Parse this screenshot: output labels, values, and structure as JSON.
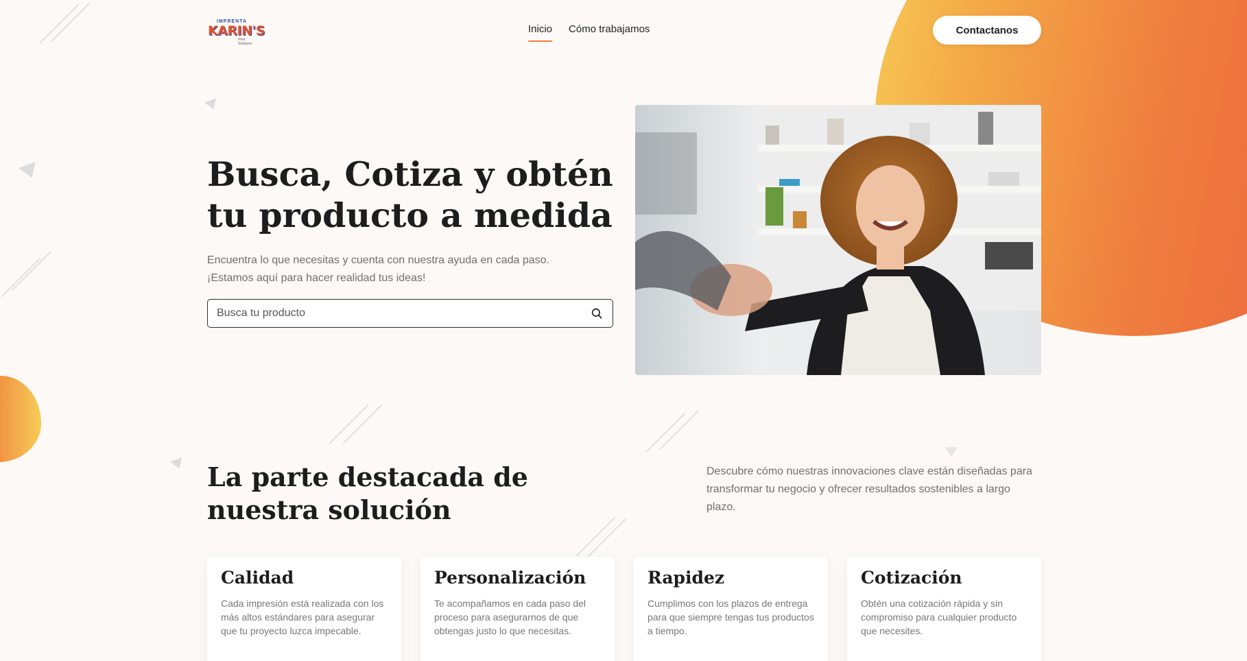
{
  "header": {
    "logo": {
      "top_text": "IMPRENTA",
      "main_text": "KARIN'S",
      "tagline": "Print Solutions"
    },
    "nav": [
      {
        "label": "Inicio",
        "active": true
      },
      {
        "label": "Cómo trabajamos",
        "active": false
      }
    ],
    "contact_button": "Contactanos"
  },
  "hero": {
    "title": "Busca, Cotiza y obtén tu producto a medida",
    "subtitle_line1": "Encuentra lo que necesitas y cuenta con nuestra ayuda en cada paso.",
    "subtitle_line2": "¡Estamos aquí para hacer realidad tus ideas!",
    "search_placeholder": "Busca tu producto"
  },
  "features": {
    "title": "La parte destacada de nuestra solución",
    "description": "Descubre cómo nuestras innovaciones clave están diseñadas para transformar tu negocio y ofrecer resultados sostenibles a largo plazo.",
    "cards": [
      {
        "title": "Calidad",
        "text": "Cada impresión está realizada con los más altos estándares para asegurar que tu proyecto luzca impecable."
      },
      {
        "title": "Personalización",
        "text": "Te acompañamos en cada paso del proceso para asegurarnos de que obtengas justo lo que necesitas."
      },
      {
        "title": "Rapidez",
        "text": "Cumplimos con los plazos de entrega para que siempre tengas tus productos a tiempo."
      },
      {
        "title": "Cotización",
        "text": "Obtén una cotización rápida y sin compromiso para cualquier producto que necesites."
      }
    ]
  },
  "colors": {
    "accent_orange": "#ef7d3f",
    "gradient_yellow": "#f7cc57",
    "gradient_red": "#ea5f3c",
    "background": "#fdf9f7"
  }
}
